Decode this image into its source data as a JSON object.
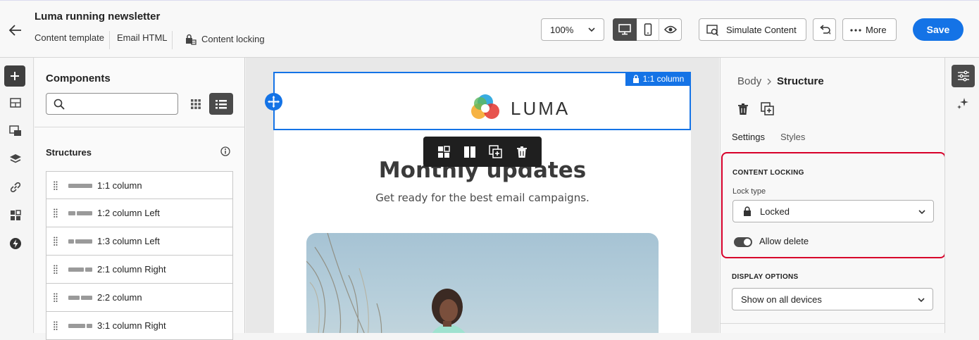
{
  "header": {
    "title": "Luma running newsletter",
    "subnav": [
      "Content template",
      "Email HTML"
    ],
    "content_locking_label": "Content locking",
    "zoom_value": "100%",
    "simulate_label": "Simulate Content",
    "more_label": "More",
    "save_label": "Save"
  },
  "components": {
    "title": "Components",
    "search_placeholder": "",
    "structures_title": "Structures",
    "structures": [
      {
        "label": "1:1 column",
        "shape": [
          1
        ]
      },
      {
        "label": "1:2 column Left",
        "shape": [
          1,
          2
        ]
      },
      {
        "label": "1:3 column Left",
        "shape": [
          1,
          3
        ]
      },
      {
        "label": "2:1 column Right",
        "shape": [
          2,
          1
        ]
      },
      {
        "label": "2:2 column",
        "shape": [
          1,
          1
        ]
      },
      {
        "label": "3:1 column Right",
        "shape": [
          3,
          1
        ]
      }
    ]
  },
  "canvas": {
    "lock_badge": "1:1 column",
    "logo_text": "LUMA",
    "headline": "Monthly updates",
    "subheadline": "Get ready for the best email campaigns."
  },
  "properties": {
    "breadcrumb_parent": "Body",
    "breadcrumb_current": "Structure",
    "tabs": [
      "Settings",
      "Styles"
    ],
    "content_locking": {
      "title": "CONTENT LOCKING",
      "lock_type_label": "Lock type",
      "lock_type_value": "Locked",
      "allow_delete_label": "Allow delete",
      "allow_delete_on": true
    },
    "display_options": {
      "title": "DISPLAY OPTIONS",
      "value": "Show on all devices"
    }
  },
  "colors": {
    "accent": "#1473e6",
    "highlight_border": "#d7002a",
    "toolbar_bg": "#1f1f1f"
  },
  "icons": [
    "back-arrow-icon",
    "content-locking-icon",
    "chevron-down-icon",
    "desktop-icon",
    "mobile-icon",
    "eye-icon",
    "simulate-icon",
    "undo-icon",
    "more-dots-icon",
    "plus-icon",
    "structures-icon",
    "fragments-icon",
    "layers-icon",
    "link-icon",
    "components-icon",
    "lightning-icon",
    "search-icon",
    "grid-view-icon",
    "list-view-icon",
    "info-icon",
    "grip-icon",
    "lock-icon",
    "move-icon",
    "select-parent-icon",
    "columns-icon",
    "duplicate-icon",
    "delete-icon",
    "settings-sliders-icon",
    "sparkle-icon"
  ]
}
